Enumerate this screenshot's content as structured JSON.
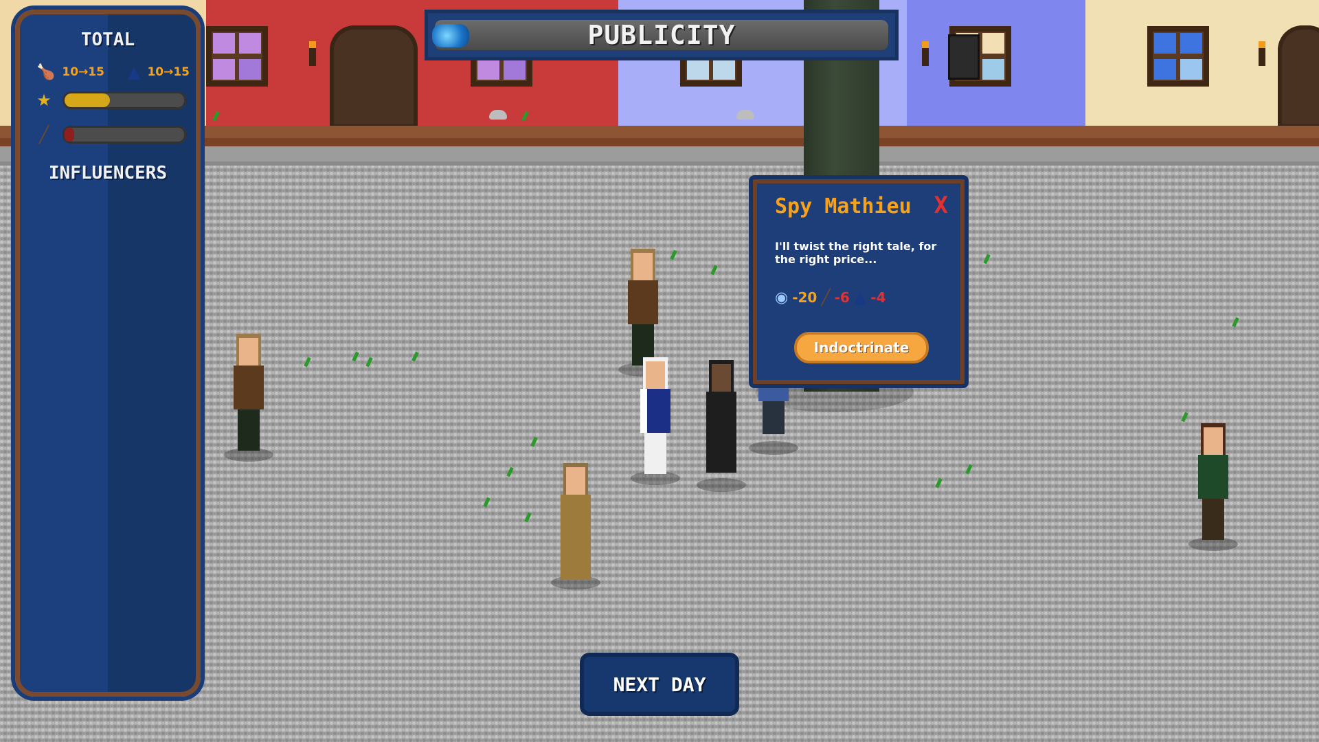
{
  "hud": {
    "publicity_title": "PUBLICITY",
    "publicity_level": 0.06
  },
  "sidebar": {
    "total_title": "TOTAL",
    "food_range": "10→15",
    "hat_range": "10→15",
    "star_meter": 0.38,
    "musket_meter": 0.08,
    "influencers_title": "INFLUENCERS"
  },
  "popup": {
    "name": "Spy Mathieu",
    "close": "X",
    "quote": "I'll twist the right tale, for the right price...",
    "effects": [
      {
        "icon": "eye-icon",
        "value": "-20",
        "color": "#f6a21b"
      },
      {
        "icon": "musket-icon",
        "value": "-6",
        "color": "#e53030"
      },
      {
        "icon": "bicorne-hat-icon",
        "value": "-4",
        "color": "#e53030"
      }
    ],
    "button": "Indoctrinate"
  },
  "footer": {
    "next_day": "NEXT DAY"
  },
  "colors": {
    "panel_blue": "#1c3f7d",
    "panel_border": "#7a4a2e",
    "accent_orange": "#f6a21b",
    "accent_red": "#e53030",
    "cobblestone": "#a6a6a6"
  }
}
